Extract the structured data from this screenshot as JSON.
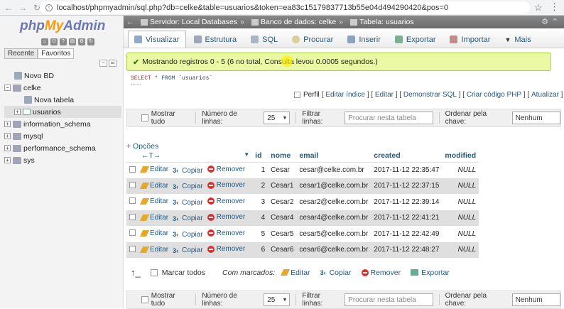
{
  "browser": {
    "url": "localhost/phpmyadmin/sql.php?db=celke&table=usuarios&token=ea83c15179837713b55e04d494290420&pos=0"
  },
  "left_panel": {
    "logo_php": "php",
    "logo_my": "My",
    "logo_admin": "Admin",
    "tabs": [
      "Recente",
      "Favoritos"
    ],
    "tree": [
      {
        "label": "Novo BD",
        "level": 0
      },
      {
        "label": "celke",
        "level": 0
      },
      {
        "label": "Nova tabela",
        "level": 1
      },
      {
        "label": "usuarios",
        "level": 1
      },
      {
        "label": "information_schema",
        "level": 0
      },
      {
        "label": "mysql",
        "level": 0
      },
      {
        "label": "performance_schema",
        "level": 0
      },
      {
        "label": "sys",
        "level": 0
      }
    ]
  },
  "breadcrumb": {
    "server": "Servidor: Local Databases",
    "database": "Banco de dados: celke",
    "table": "Tabela: usuarios"
  },
  "tabs": [
    "Visualizar",
    "Estrutura",
    "SQL",
    "Procurar",
    "Inserir",
    "Exportar",
    "Importar",
    "Mais"
  ],
  "notice": "Mostrando registros 0 - 5 (6 no total, Consulta levou 0.0005 segundos.)",
  "sql": {
    "select": "SELECT",
    "rest": "* FROM",
    "table": "`usuarios`"
  },
  "query_links": {
    "perfil": "Perfil",
    "links": [
      "Editar índice",
      "Editar",
      "Demonstrar SQL",
      "Criar código PHP",
      "Atualizar"
    ]
  },
  "nav": {
    "show_all": "Mostrar tudo",
    "rows_label": "Número de linhas:",
    "rows_value": "25",
    "filter_label": "Filtrar linhas:",
    "filter_placeholder": "Procurar nesta tabela",
    "order_label": "Ordenar pela chave:",
    "order_value": "Nenhum"
  },
  "options_label": "+ Opções",
  "arrows_label": "←T→",
  "columns": [
    "id",
    "nome",
    "email",
    "created",
    "modified"
  ],
  "actions": {
    "edit": "Editar",
    "copy": "Copiar",
    "delete": "Remover"
  },
  "rows": [
    {
      "id": "1",
      "nome": "Cesar",
      "email": "cesar@celke.com.br",
      "created": "2017-11-12 22:35:47",
      "modified": "NULL"
    },
    {
      "id": "2",
      "nome": "Cesar1",
      "email": "cesar1@celke.com.br",
      "created": "2017-11-12 22:37:15",
      "modified": "NULL"
    },
    {
      "id": "3",
      "nome": "Cesar2",
      "email": "cesar2@celke.com.br",
      "created": "2017-11-12 22:39:14",
      "modified": "NULL"
    },
    {
      "id": "4",
      "nome": "Cesar4",
      "email": "cesar4@celke.com.br",
      "created": "2017-11-12 22:41:21",
      "modified": "NULL"
    },
    {
      "id": "5",
      "nome": "Cesar5",
      "email": "cesar5@celke.com.br",
      "created": "2017-11-12 22:42:49",
      "modified": "NULL"
    },
    {
      "id": "6",
      "nome": "Cesar6",
      "email": "cesar6@celke.com.br",
      "created": "2017-11-12 22:48:27",
      "modified": "NULL"
    }
  ],
  "bulk": {
    "check_all": "Marcar todos",
    "with_selected": "Com marcados:",
    "edit": "Editar",
    "copy": "Copiar",
    "delete": "Remover",
    "export": "Exportar"
  }
}
